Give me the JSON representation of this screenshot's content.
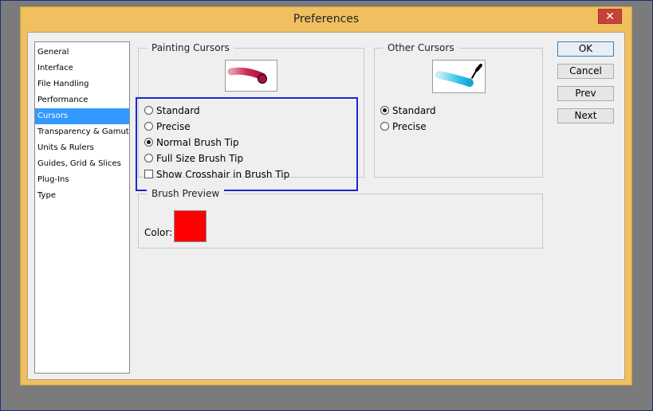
{
  "window": {
    "title": "Preferences",
    "close_glyph": "✕"
  },
  "sidebar": {
    "items": [
      {
        "label": "General"
      },
      {
        "label": "Interface"
      },
      {
        "label": "File Handling"
      },
      {
        "label": "Performance"
      },
      {
        "label": "Cursors",
        "selected": true
      },
      {
        "label": "Transparency & Gamut"
      },
      {
        "label": "Units & Rulers"
      },
      {
        "label": "Guides, Grid & Slices"
      },
      {
        "label": "Plug-Ins"
      },
      {
        "label": "Type"
      }
    ]
  },
  "painting_cursors": {
    "title": "Painting Cursors",
    "options": [
      {
        "label": "Standard",
        "kind": "radio",
        "checked": false
      },
      {
        "label": "Precise",
        "kind": "radio",
        "checked": false
      },
      {
        "label": "Normal Brush Tip",
        "kind": "radio",
        "checked": true
      },
      {
        "label": "Full Size Brush Tip",
        "kind": "radio",
        "checked": false
      },
      {
        "label": "Show Crosshair in Brush Tip",
        "kind": "checkbox",
        "checked": false
      }
    ]
  },
  "other_cursors": {
    "title": "Other Cursors",
    "options": [
      {
        "label": "Standard",
        "checked": true
      },
      {
        "label": "Precise",
        "checked": false
      }
    ]
  },
  "brush_preview": {
    "title": "Brush Preview",
    "color_label": "Color:",
    "color": "#ff0000"
  },
  "buttons": {
    "ok": "OK",
    "cancel": "Cancel",
    "prev": "Prev",
    "next": "Next"
  },
  "colors": {
    "selection": "#3399ff",
    "highlight": "#1a2ac8",
    "titlebar": "#f0c060",
    "close": "#c7413b"
  }
}
